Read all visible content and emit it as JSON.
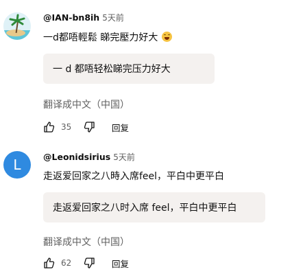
{
  "comments": [
    {
      "avatar_type": "image",
      "avatar_letter": "",
      "handle": "@IAN-bn8ih",
      "time": "5天前",
      "text": "一d都唔輕鬆 睇完壓力好大",
      "emoji": "grinning-sweat-emoji",
      "translation": "一 d 都唔轻松睇完压力好大",
      "translate_label": "翻译成中文（中国）",
      "likes": "35",
      "reply_label": "回复"
    },
    {
      "avatar_type": "letter",
      "avatar_letter": "L",
      "avatar_color": "#2f8ae0",
      "handle": "@Leonidsirius",
      "time": "5天前",
      "text": "走返爱回家之八時入席feel，平白中更平白",
      "translation": "走返爱回家之八时入席 feel，平白中更平白",
      "translate_label": "翻译成中文（中国）",
      "likes": "62",
      "reply_label": "回复"
    }
  ]
}
